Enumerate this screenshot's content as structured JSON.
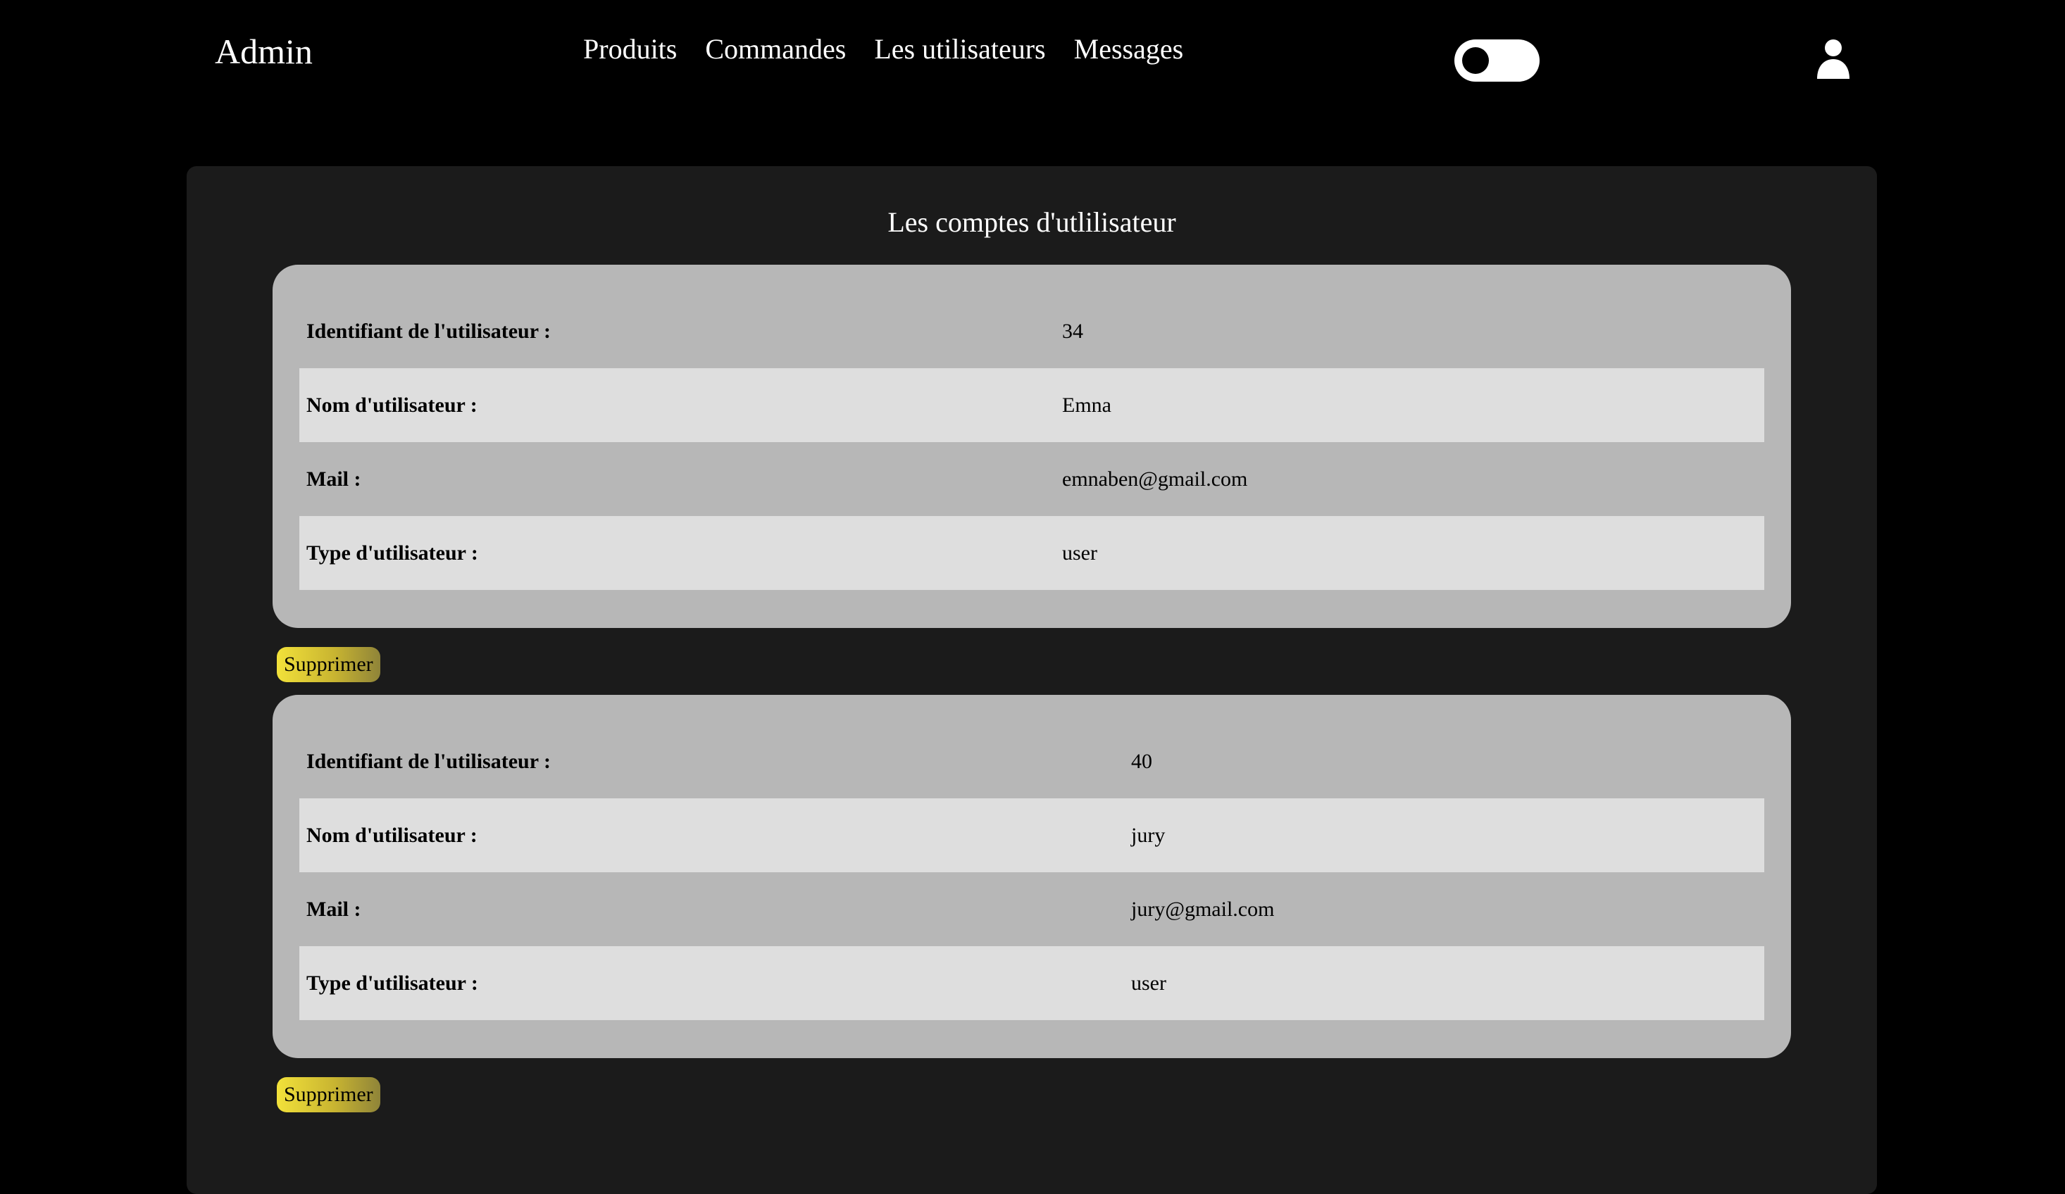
{
  "header": {
    "brand": "Admin",
    "nav": [
      "Produits",
      "Commandes",
      "Les utilisateurs",
      "Messages"
    ],
    "icons": {
      "theme_toggle": "toggle-switch-icon",
      "account": "user-icon"
    }
  },
  "main": {
    "title": "Les comptes d'utlilisateur",
    "labels": {
      "id": "Identifiant de l'utilisateur :",
      "name": "Nom d'utilisateur :",
      "mail": "Mail :",
      "type": "Type d'utilisateur :"
    },
    "delete_label": "Supprimer",
    "users": [
      {
        "id": "34",
        "name": "Emna",
        "mail": "emnaben@gmail.com",
        "type": "user"
      },
      {
        "id": "40",
        "name": "jury",
        "mail": "jury@gmail.com",
        "type": "user"
      }
    ]
  },
  "colors": {
    "background": "#000000",
    "panel": "#1b1b1b",
    "card": "#b7b7b7",
    "row_alt": "#dedede",
    "button_accent": "#f2e13a"
  }
}
